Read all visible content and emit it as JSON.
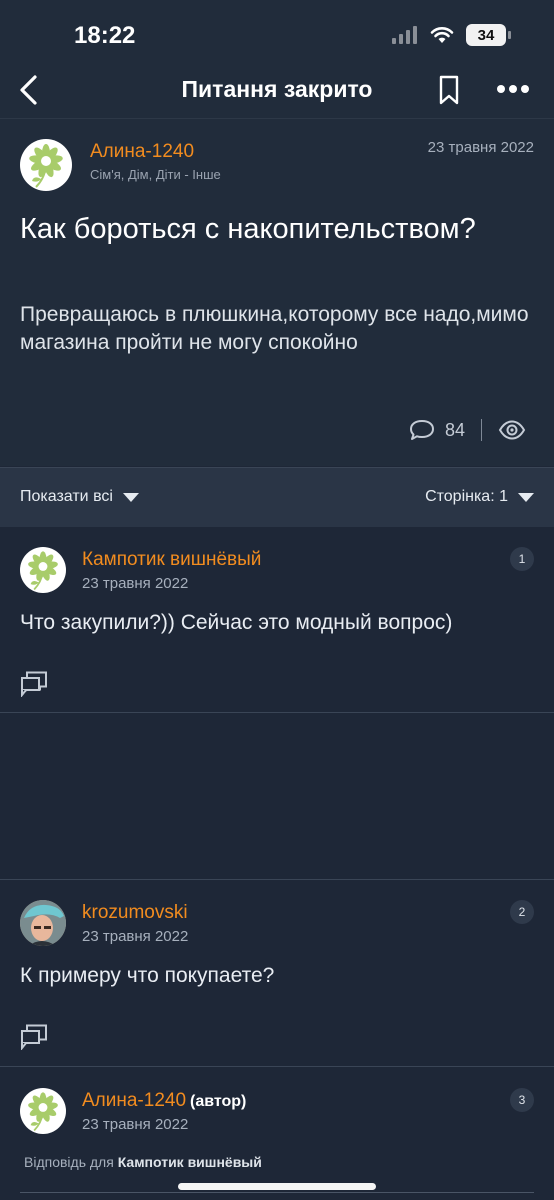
{
  "status": {
    "time": "18:22",
    "battery": "34"
  },
  "nav": {
    "title": "Питання закрито"
  },
  "question": {
    "author": "Алина-1240",
    "category": "Сім'я, Дім, Діти - Інше",
    "date": "23 травня 2022",
    "title": "Как бороться с накопительством?",
    "body": "Превращаюсь в плюшкина,которому все надо,мимо магазина пройти не могу спокойно",
    "comments": "84"
  },
  "filter": {
    "show_all": "Показати всі",
    "page": "Сторінка: 1"
  },
  "answers": [
    {
      "author": "Кампотик вишнёвый",
      "date": "23 травня 2022",
      "number": "1",
      "text": "Что закупили?)) Сейчас это модный вопрос)"
    },
    {
      "author": "krozumovski",
      "date": "23 травня 2022",
      "number": "2",
      "text": "К примеру что покупаете?"
    },
    {
      "author": "Алина-1240",
      "author_tag": "(автор)",
      "date": "23 травня 2022",
      "number": "3",
      "reply_label": "Відповідь для",
      "reply_to": "Кампотик вишнёвый"
    }
  ],
  "colors": {
    "accent": "#f28c1f",
    "background": "#1e2737",
    "card": "#212c3b"
  }
}
